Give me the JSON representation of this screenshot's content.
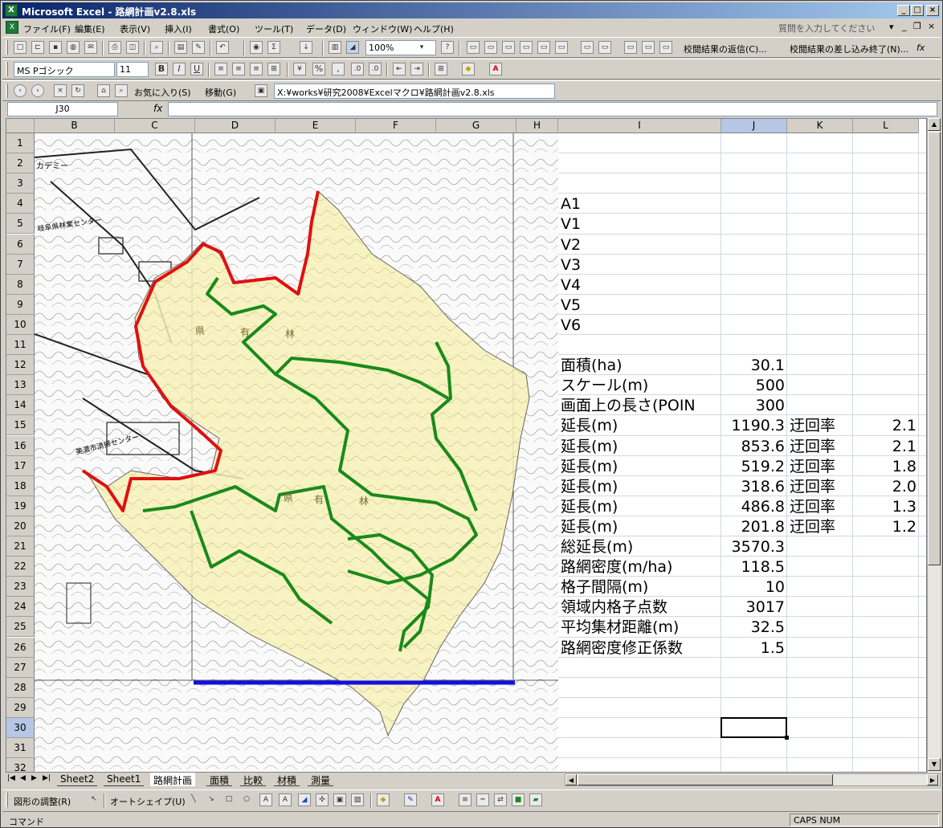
{
  "window": {
    "title": "Microsoft Excel - 路網計画v2.8.xls",
    "min_label": "_",
    "max_label": "□",
    "close_label": "×"
  },
  "menu": {
    "items": [
      "ファイル(F)",
      "編集(E)",
      "表示(V)",
      "挿入(I)",
      "書式(O)",
      "ツール(T)",
      "データ(D)",
      "ウィンドウ(W)",
      "ヘルプ(H)"
    ],
    "help_placeholder": "質問を入力してください"
  },
  "toolbar_standard": {
    "zoom": "100%",
    "review_reply": "校閲結果の返信(C)...",
    "review_end": "校閲結果の差し込み終了(N)..."
  },
  "toolbar_format": {
    "font_name": "MS Pゴシック",
    "font_size": "11",
    "bold": "B",
    "italic": "I",
    "underline": "U",
    "percent": "%",
    "comma": ","
  },
  "toolbar_web": {
    "favorites": "お気に入り(S)",
    "goto": "移動(G)",
    "address": "X:¥works¥研究2008¥Excelマクロ¥路網計画v2.8.xls"
  },
  "formula": {
    "cell_ref": "J30",
    "fx": "fx"
  },
  "columns": [
    "B",
    "C",
    "D",
    "E",
    "F",
    "G",
    "H",
    "I",
    "J",
    "K",
    "L"
  ],
  "rows": [
    "1",
    "2",
    "3",
    "4",
    "5",
    "6",
    "7",
    "8",
    "9",
    "10",
    "11",
    "12",
    "13",
    "14",
    "15",
    "16",
    "17",
    "18",
    "19",
    "20",
    "21",
    "22",
    "23",
    "24",
    "25",
    "26",
    "27",
    "28",
    "29",
    "30",
    "31",
    "32"
  ],
  "map": {
    "labels": [
      "カデミー",
      "岐阜県林業センター",
      "県",
      "有",
      "林",
      "県",
      "有",
      "林",
      "美濃市清掃センター"
    ]
  },
  "cells": {
    "I": {
      "4": "A1",
      "5": "V1",
      "6": "V2",
      "7": "V3",
      "8": "V4",
      "9": "V5",
      "10": "V6",
      "12": "面積(ha)",
      "13": "スケール(m)",
      "14": "画面上の長さ(POIN",
      "15": "延長(m)",
      "16": "延長(m)",
      "17": "延長(m)",
      "18": "延長(m)",
      "19": "延長(m)",
      "20": "延長(m)",
      "21": "総延長(m)",
      "22": "路網密度(m/ha)",
      "23": "格子間隔(m)",
      "24": "領域内格子点数",
      "25": "平均集材距離(m)",
      "26": "路網密度修正係数"
    },
    "J": {
      "12": "30.1",
      "13": "500",
      "14": "300",
      "15": "1190.3",
      "16": "853.6",
      "17": "519.2",
      "18": "318.6",
      "19": "486.8",
      "20": "201.8",
      "21": "3570.3",
      "22": "118.5",
      "23": "10",
      "24": "3017",
      "25": "32.5",
      "26": "1.5"
    },
    "K": {
      "15": "迂回率",
      "16": "迂回率",
      "17": "迂回率",
      "18": "迂回率",
      "19": "迂回率",
      "20": "迂回率"
    },
    "L": {
      "15": "2.1",
      "16": "2.1",
      "17": "1.8",
      "18": "2.0",
      "19": "1.3",
      "20": "1.2"
    }
  },
  "sheet_tabs": [
    "Sheet2",
    "Sheet1",
    "路網計画",
    "面積",
    "比較",
    "材積",
    "測量"
  ],
  "active_tab": "路網計画",
  "drawing_toolbar": {
    "adjust": "図形の調整(R)",
    "autoshape": "オートシェイプ(U)"
  },
  "status": {
    "mode": "コマンド",
    "indicators": "CAPS NUM"
  },
  "colors": {
    "boundary_red": "#e01010",
    "route_green": "#1a8a1a",
    "scale_blue": "#1010e0",
    "area_fill": "#f7f1b8"
  }
}
